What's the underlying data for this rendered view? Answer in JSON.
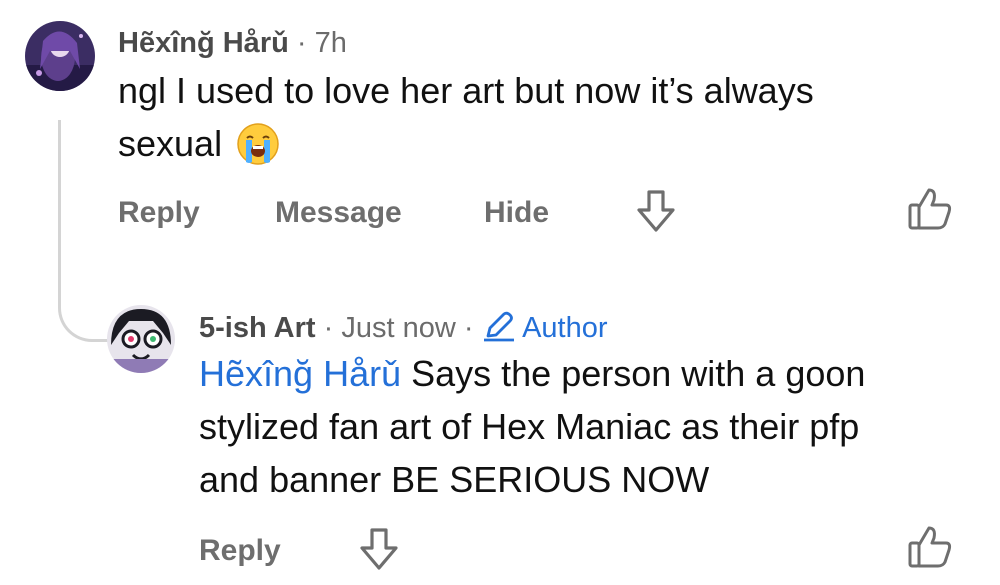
{
  "comment": {
    "author": "Hẽxînğ Hårǔ",
    "sep": "·",
    "time": "7h",
    "line1": "ngl I used to love her art but now it’s always",
    "line2": "sexual",
    "emoji": "loudly-crying-face-emoji",
    "actions": {
      "reply": "Reply",
      "message": "Message",
      "hide": "Hide"
    },
    "icons": {
      "downvote": "arrow-down-icon",
      "like": "thumbs-up-icon"
    }
  },
  "reply": {
    "author": "5-ish Art",
    "sep1": "·",
    "time": "Just now",
    "sep2": "·",
    "badge": "Author",
    "badge_icon": "pencil-icon",
    "mention": "Hẽxînğ Hårǔ",
    "line1_rest": " Says the person with a goon",
    "line2": "stylized fan art of Hex Maniac as their pfp",
    "line3": "and banner BE SERIOUS NOW",
    "actions": {
      "reply": "Reply"
    },
    "icons": {
      "downvote": "arrow-down-icon",
      "like": "thumbs-up-icon"
    }
  },
  "colors": {
    "mention": "#2470d8",
    "meta": "#6b6b6b",
    "action": "#6e6e6e"
  }
}
